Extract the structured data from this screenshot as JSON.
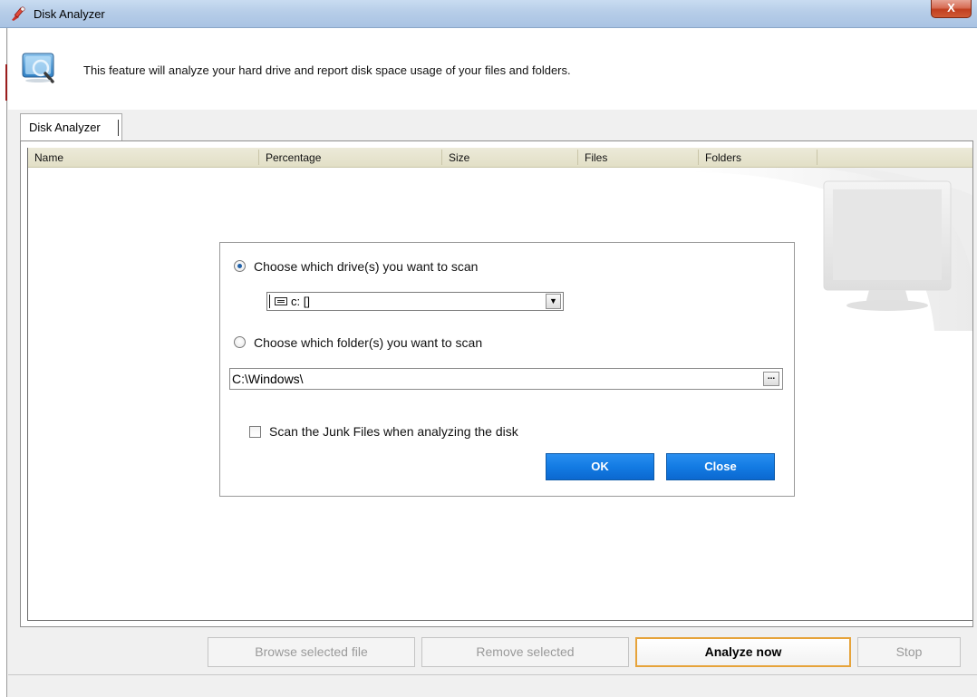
{
  "window": {
    "title": "Disk Analyzer",
    "close_label": "X"
  },
  "header": {
    "description": "This feature will analyze your hard drive and report disk space usage of your files and folders."
  },
  "tabs": [
    {
      "label": "Disk Analyzer"
    }
  ],
  "table": {
    "columns": [
      "Name",
      "Percentage",
      "Size",
      "Files",
      "Folders"
    ]
  },
  "dialog": {
    "drive_option_label": "Choose which drive(s) you want to scan",
    "drive_selected": "c: []",
    "folder_option_label": "Choose which folder(s) you want to scan",
    "folder_path": "C:\\Windows\\",
    "browse_label": "...",
    "junk_checkbox_label": "Scan the Junk Files when analyzing the disk",
    "ok_label": "OK",
    "close_label": "Close"
  },
  "toolbar": {
    "browse_selected_label": "Browse selected file",
    "remove_selected_label": "Remove selected",
    "analyze_label": "Analyze now",
    "stop_label": "Stop"
  },
  "colors": {
    "accent_blue": "#137be3",
    "focus_orange": "#e6a33a",
    "column_header": "#e2dfc6"
  }
}
